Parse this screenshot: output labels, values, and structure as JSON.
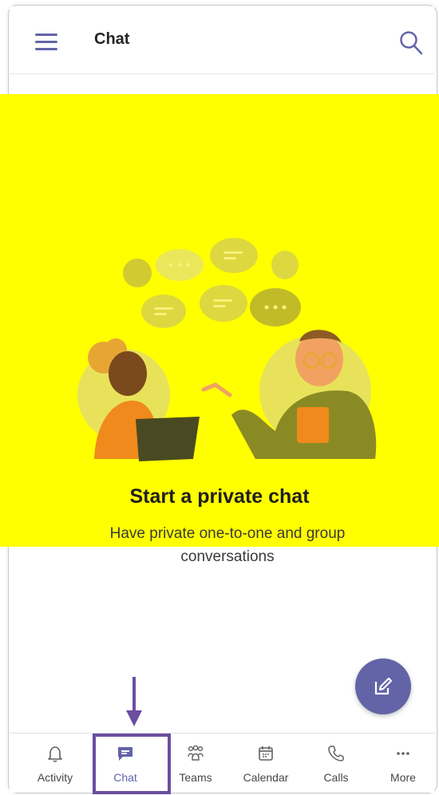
{
  "header": {
    "title": "Chat"
  },
  "empty_state": {
    "headline": "Start a private chat",
    "subtext": "Have private one-to-one and group conversations"
  },
  "fab": {
    "icon": "compose-icon"
  },
  "tabs": [
    {
      "label": "Activity",
      "icon": "bell-icon"
    },
    {
      "label": "Chat",
      "icon": "chat-icon",
      "active": true
    },
    {
      "label": "Teams",
      "icon": "teams-icon"
    },
    {
      "label": "Calendar",
      "icon": "calendar-icon"
    },
    {
      "label": "Calls",
      "icon": "phone-icon"
    },
    {
      "label": "More",
      "icon": "more-icon"
    }
  ],
  "colors": {
    "accent": "#6264a7",
    "highlight_box": "#6a4e9f",
    "hero_background": "#ffff00"
  }
}
